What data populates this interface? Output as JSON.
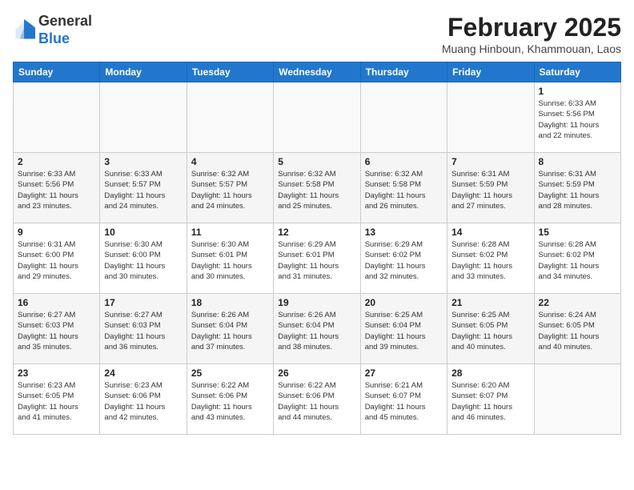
{
  "header": {
    "logo_general": "General",
    "logo_blue": "Blue",
    "month_title": "February 2025",
    "location": "Muang Hinboun, Khammouan, Laos"
  },
  "weekdays": [
    "Sunday",
    "Monday",
    "Tuesday",
    "Wednesday",
    "Thursday",
    "Friday",
    "Saturday"
  ],
  "weeks": [
    [
      {
        "day": "",
        "info": ""
      },
      {
        "day": "",
        "info": ""
      },
      {
        "day": "",
        "info": ""
      },
      {
        "day": "",
        "info": ""
      },
      {
        "day": "",
        "info": ""
      },
      {
        "day": "",
        "info": ""
      },
      {
        "day": "1",
        "info": "Sunrise: 6:33 AM\nSunset: 5:56 PM\nDaylight: 11 hours\nand 22 minutes."
      }
    ],
    [
      {
        "day": "2",
        "info": "Sunrise: 6:33 AM\nSunset: 5:56 PM\nDaylight: 11 hours\nand 23 minutes."
      },
      {
        "day": "3",
        "info": "Sunrise: 6:33 AM\nSunset: 5:57 PM\nDaylight: 11 hours\nand 24 minutes."
      },
      {
        "day": "4",
        "info": "Sunrise: 6:32 AM\nSunset: 5:57 PM\nDaylight: 11 hours\nand 24 minutes."
      },
      {
        "day": "5",
        "info": "Sunrise: 6:32 AM\nSunset: 5:58 PM\nDaylight: 11 hours\nand 25 minutes."
      },
      {
        "day": "6",
        "info": "Sunrise: 6:32 AM\nSunset: 5:58 PM\nDaylight: 11 hours\nand 26 minutes."
      },
      {
        "day": "7",
        "info": "Sunrise: 6:31 AM\nSunset: 5:59 PM\nDaylight: 11 hours\nand 27 minutes."
      },
      {
        "day": "8",
        "info": "Sunrise: 6:31 AM\nSunset: 5:59 PM\nDaylight: 11 hours\nand 28 minutes."
      }
    ],
    [
      {
        "day": "9",
        "info": "Sunrise: 6:31 AM\nSunset: 6:00 PM\nDaylight: 11 hours\nand 29 minutes."
      },
      {
        "day": "10",
        "info": "Sunrise: 6:30 AM\nSunset: 6:00 PM\nDaylight: 11 hours\nand 30 minutes."
      },
      {
        "day": "11",
        "info": "Sunrise: 6:30 AM\nSunset: 6:01 PM\nDaylight: 11 hours\nand 30 minutes."
      },
      {
        "day": "12",
        "info": "Sunrise: 6:29 AM\nSunset: 6:01 PM\nDaylight: 11 hours\nand 31 minutes."
      },
      {
        "day": "13",
        "info": "Sunrise: 6:29 AM\nSunset: 6:02 PM\nDaylight: 11 hours\nand 32 minutes."
      },
      {
        "day": "14",
        "info": "Sunrise: 6:28 AM\nSunset: 6:02 PM\nDaylight: 11 hours\nand 33 minutes."
      },
      {
        "day": "15",
        "info": "Sunrise: 6:28 AM\nSunset: 6:02 PM\nDaylight: 11 hours\nand 34 minutes."
      }
    ],
    [
      {
        "day": "16",
        "info": "Sunrise: 6:27 AM\nSunset: 6:03 PM\nDaylight: 11 hours\nand 35 minutes."
      },
      {
        "day": "17",
        "info": "Sunrise: 6:27 AM\nSunset: 6:03 PM\nDaylight: 11 hours\nand 36 minutes."
      },
      {
        "day": "18",
        "info": "Sunrise: 6:26 AM\nSunset: 6:04 PM\nDaylight: 11 hours\nand 37 minutes."
      },
      {
        "day": "19",
        "info": "Sunrise: 6:26 AM\nSunset: 6:04 PM\nDaylight: 11 hours\nand 38 minutes."
      },
      {
        "day": "20",
        "info": "Sunrise: 6:25 AM\nSunset: 6:04 PM\nDaylight: 11 hours\nand 39 minutes."
      },
      {
        "day": "21",
        "info": "Sunrise: 6:25 AM\nSunset: 6:05 PM\nDaylight: 11 hours\nand 40 minutes."
      },
      {
        "day": "22",
        "info": "Sunrise: 6:24 AM\nSunset: 6:05 PM\nDaylight: 11 hours\nand 40 minutes."
      }
    ],
    [
      {
        "day": "23",
        "info": "Sunrise: 6:23 AM\nSunset: 6:05 PM\nDaylight: 11 hours\nand 41 minutes."
      },
      {
        "day": "24",
        "info": "Sunrise: 6:23 AM\nSunset: 6:06 PM\nDaylight: 11 hours\nand 42 minutes."
      },
      {
        "day": "25",
        "info": "Sunrise: 6:22 AM\nSunset: 6:06 PM\nDaylight: 11 hours\nand 43 minutes."
      },
      {
        "day": "26",
        "info": "Sunrise: 6:22 AM\nSunset: 6:06 PM\nDaylight: 11 hours\nand 44 minutes."
      },
      {
        "day": "27",
        "info": "Sunrise: 6:21 AM\nSunset: 6:07 PM\nDaylight: 11 hours\nand 45 minutes."
      },
      {
        "day": "28",
        "info": "Sunrise: 6:20 AM\nSunset: 6:07 PM\nDaylight: 11 hours\nand 46 minutes."
      },
      {
        "day": "",
        "info": ""
      }
    ]
  ]
}
